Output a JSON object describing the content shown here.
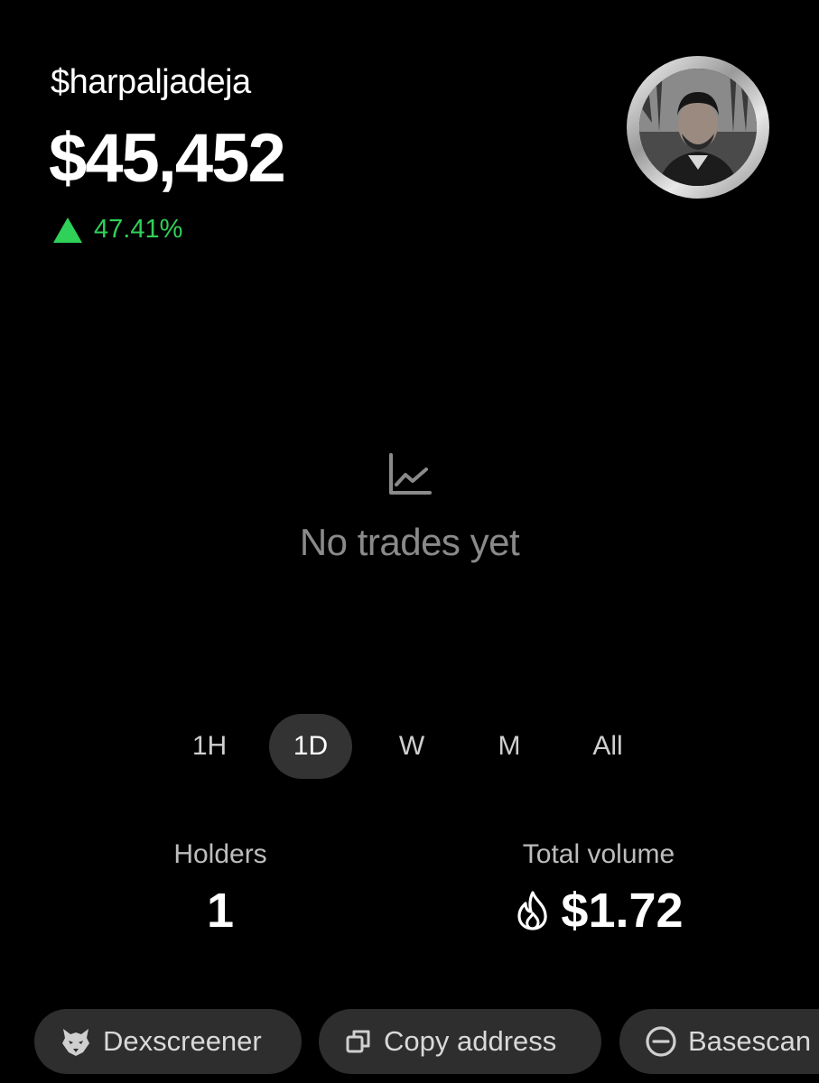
{
  "token": {
    "ticker": "$harpaljadeja",
    "price": "$45,452",
    "change": "47.41%",
    "change_direction": "up"
  },
  "colors": {
    "positive": "#2fd158",
    "background": "#000000",
    "pill_bg": "#2e2e2e",
    "muted_text": "#8a8a8a"
  },
  "chart": {
    "empty_icon": "line-chart-icon",
    "empty_message": "No trades yet"
  },
  "ranges": [
    {
      "label": "1H",
      "active": false
    },
    {
      "label": "1D",
      "active": true
    },
    {
      "label": "W",
      "active": false
    },
    {
      "label": "M",
      "active": false
    },
    {
      "label": "All",
      "active": false
    }
  ],
  "stats": {
    "holders_label": "Holders",
    "holders_value": "1",
    "volume_label": "Total volume",
    "volume_value": "$1.72",
    "volume_icon": "flame-icon"
  },
  "actions": [
    {
      "label": "Dexscreener",
      "icon": "dexscreener-icon"
    },
    {
      "label": "Copy address",
      "icon": "copy-icon"
    },
    {
      "label": "Basescan",
      "icon": "basescan-icon"
    }
  ]
}
